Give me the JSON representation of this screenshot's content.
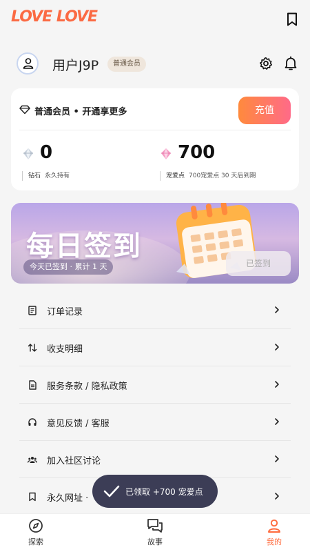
{
  "app": {
    "logo_text": "LOVE LOVE",
    "accent_color": "#ff6a3c"
  },
  "profile": {
    "username": "用户J9P",
    "member_badge": "普通会员"
  },
  "membership_card": {
    "headline": "普通会员 • 开通享更多",
    "recharge_label": "充值",
    "diamonds": {
      "value": "0",
      "label": "钻石",
      "note": "永久持有"
    },
    "points": {
      "value": "700",
      "label": "宠爱点",
      "note": "700宠爱点 30 天后到期"
    }
  },
  "checkin_banner": {
    "title": "每日签到",
    "status": "今天已签到 · 累计 1 天",
    "button_label": "已签到"
  },
  "menu": {
    "items": [
      {
        "label": "订单记录",
        "icon": "receipt-icon"
      },
      {
        "label": "收支明细",
        "icon": "swap-arrows-icon"
      },
      {
        "label": "服务条款 / 隐私政策",
        "icon": "document-icon"
      },
      {
        "label": "意见反馈 / 客服",
        "icon": "headset-icon"
      },
      {
        "label": "加入社区讨论",
        "icon": "community-icon"
      },
      {
        "label": "永久网址 · ",
        "icon": "bookmark-icon"
      }
    ]
  },
  "toast": {
    "message": "已领取 +700 宠爱点"
  },
  "tabbar": {
    "tabs": [
      {
        "label": "探索",
        "icon": "compass-icon"
      },
      {
        "label": "故事",
        "icon": "chat-bubbles-icon"
      },
      {
        "label": "我的",
        "icon": "user-icon",
        "active": true
      }
    ]
  }
}
